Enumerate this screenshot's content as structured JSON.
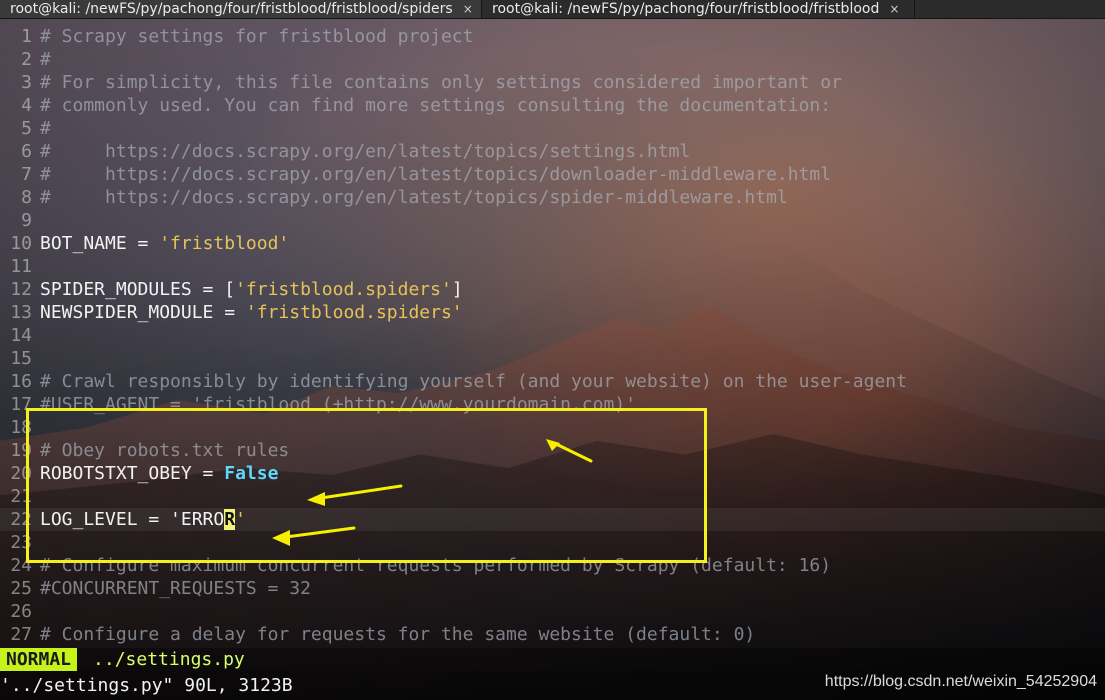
{
  "tabs": [
    {
      "title": "root@kali: /newFS/py/pachong/four/fristblood/fristblood/spiders",
      "close": "×"
    },
    {
      "title": "root@kali: /newFS/py/pachong/four/fristblood/fristblood",
      "close": "×"
    }
  ],
  "editor": {
    "lines": [
      {
        "n": "1",
        "text": "# Scrapy settings for fristblood project",
        "kind": "comment"
      },
      {
        "n": "2",
        "text": "#",
        "kind": "comment"
      },
      {
        "n": "3",
        "text": "# For simplicity, this file contains only settings considered important or",
        "kind": "comment"
      },
      {
        "n": "4",
        "text": "# commonly used. You can find more settings consulting the documentation:",
        "kind": "comment"
      },
      {
        "n": "5",
        "text": "#",
        "kind": "comment"
      },
      {
        "n": "6",
        "text": "#     https://docs.scrapy.org/en/latest/topics/settings.html",
        "kind": "comment"
      },
      {
        "n": "7",
        "text": "#     https://docs.scrapy.org/en/latest/topics/downloader-middleware.html",
        "kind": "comment"
      },
      {
        "n": "8",
        "text": "#     https://docs.scrapy.org/en/latest/topics/spider-middleware.html",
        "kind": "comment"
      },
      {
        "n": "9",
        "text": "",
        "kind": "blank"
      },
      {
        "n": "10",
        "text": "BOT_NAME = 'fristblood'",
        "kind": "code"
      },
      {
        "n": "11",
        "text": "",
        "kind": "blank"
      },
      {
        "n": "12",
        "text": "SPIDER_MODULES = ['fristblood.spiders']",
        "kind": "code"
      },
      {
        "n": "13",
        "text": "NEWSPIDER_MODULE = 'fristblood.spiders'",
        "kind": "code"
      },
      {
        "n": "14",
        "text": "",
        "kind": "blank"
      },
      {
        "n": "15",
        "text": "",
        "kind": "blank"
      },
      {
        "n": "16",
        "text": "# Crawl responsibly by identifying yourself (and your website) on the user-agent",
        "kind": "comment"
      },
      {
        "n": "17",
        "text": "#USER_AGENT = 'fristblood (+http://www.yourdomain.com)'",
        "kind": "comment"
      },
      {
        "n": "18",
        "text": "",
        "kind": "blank"
      },
      {
        "n": "19",
        "text": "# Obey robots.txt rules",
        "kind": "comment"
      },
      {
        "n": "20",
        "text": "ROBOTSTXT_OBEY = False",
        "kind": "code"
      },
      {
        "n": "21",
        "text": "",
        "kind": "blank"
      },
      {
        "n": "22",
        "text": "LOG_LEVEL = 'ERROR'",
        "kind": "code_cursor"
      },
      {
        "n": "23",
        "text": "",
        "kind": "blank"
      },
      {
        "n": "24",
        "text": "# Configure maximum concurrent requests performed by Scrapy (default: 16)",
        "kind": "comment"
      },
      {
        "n": "25",
        "text": "#CONCURRENT_REQUESTS = 32",
        "kind": "comment"
      },
      {
        "n": "26",
        "text": "",
        "kind": "blank"
      },
      {
        "n": "27",
        "text": "# Configure a delay for requests for the same website (default: 0)",
        "kind": "comment"
      }
    ]
  },
  "status": {
    "mode": "NORMAL",
    "file": "../settings.py"
  },
  "cmdline": {
    "text": "'../settings.py\" 90L, 3123B"
  },
  "watermark": {
    "text": "https://blog.csdn.net/weixin_54252904"
  },
  "colors": {
    "highlight_box": "#f3f01b",
    "arrow": "#f6f000"
  },
  "icons": {
    "close": "close-icon",
    "arrow": "yellow-arrow-icon"
  }
}
